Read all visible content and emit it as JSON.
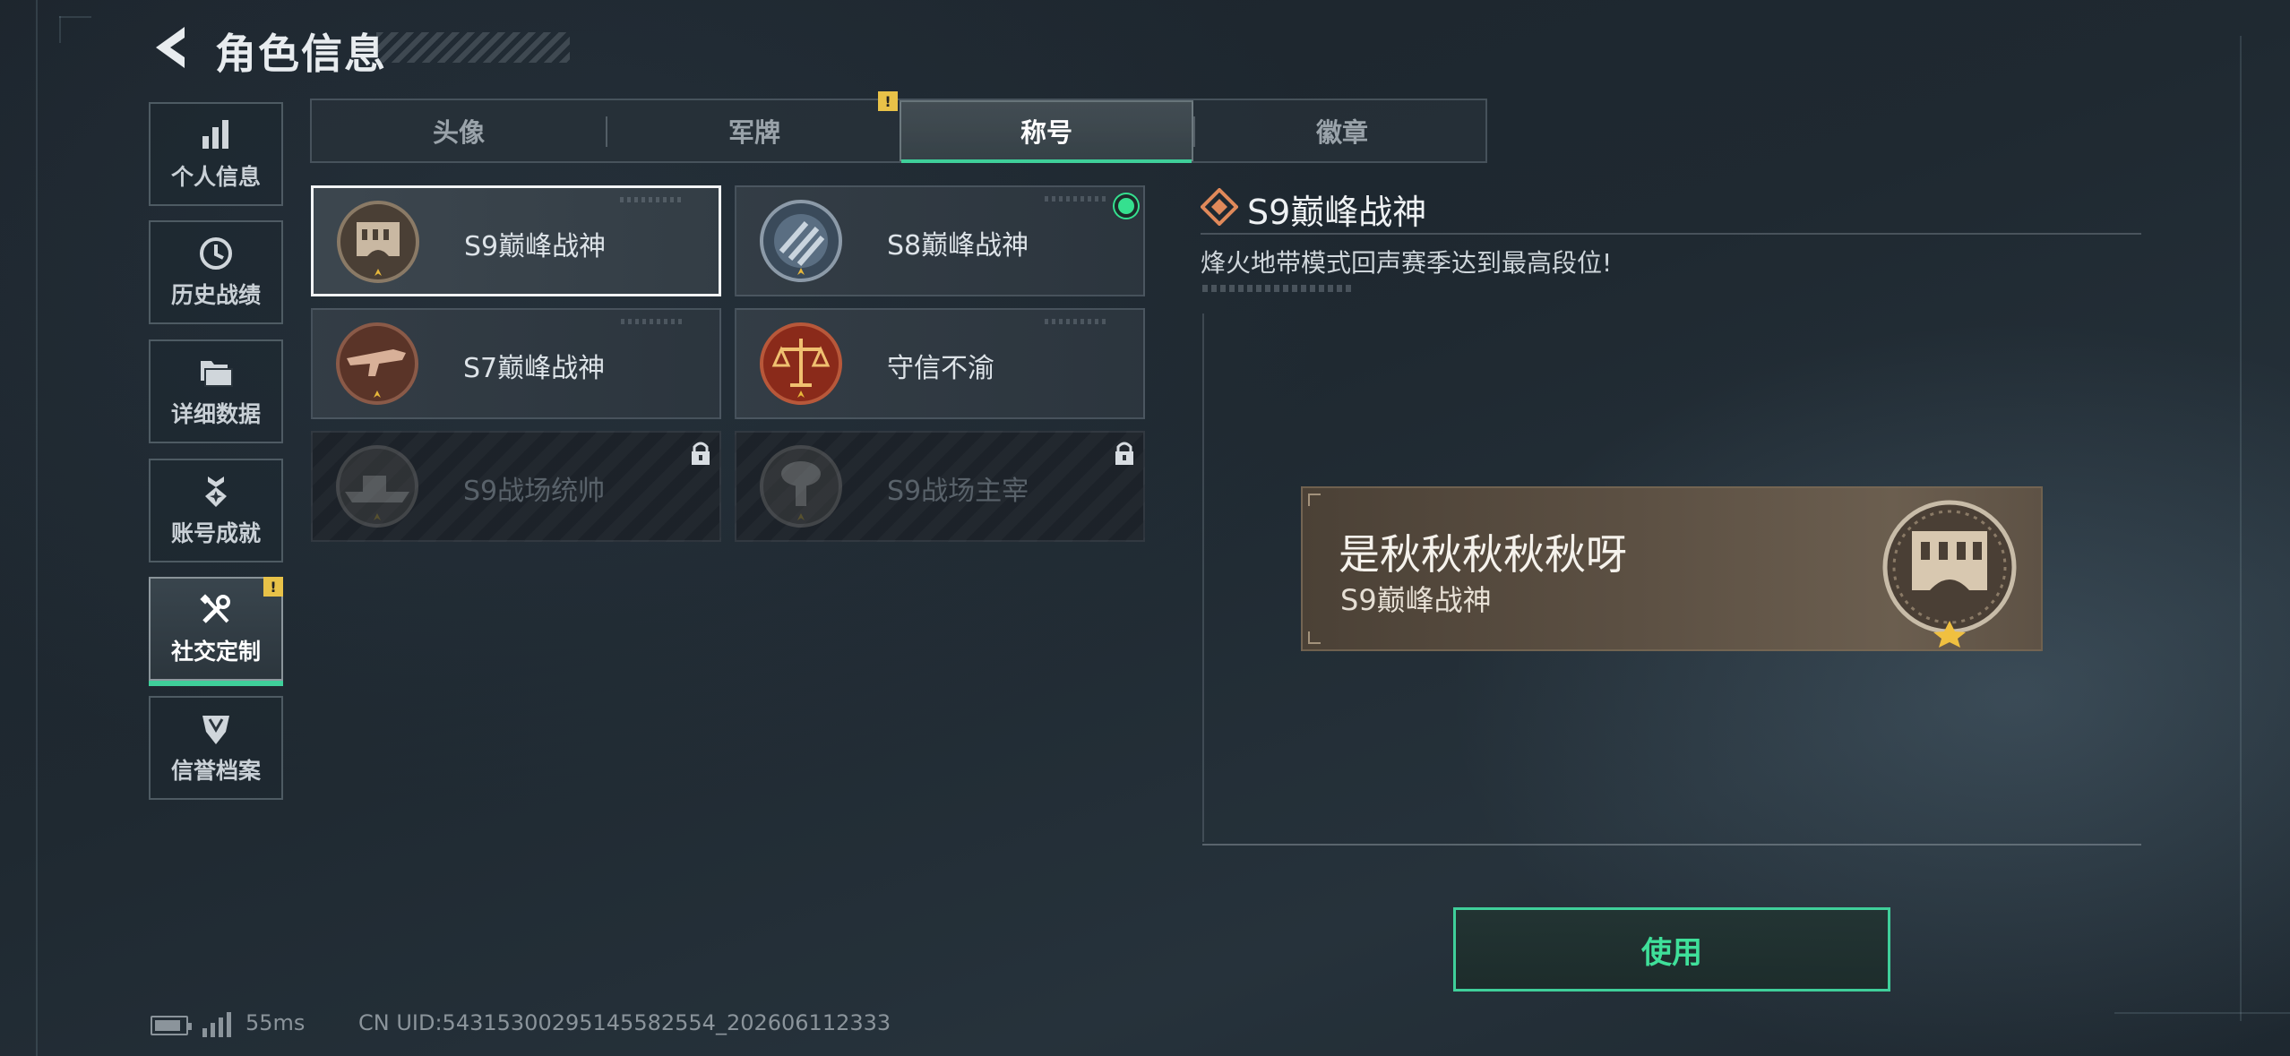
{
  "header": {
    "title": "角色信息"
  },
  "sidebar": {
    "items": [
      {
        "label": "个人信息"
      },
      {
        "label": "历史战绩"
      },
      {
        "label": "详细数据"
      },
      {
        "label": "账号成就"
      },
      {
        "label": "社交定制",
        "active": true,
        "warning": "!"
      },
      {
        "label": "信誉档案"
      }
    ]
  },
  "tabs": [
    {
      "label": "头像"
    },
    {
      "label": "军牌",
      "warning": "!"
    },
    {
      "label": "称号",
      "active": true
    },
    {
      "label": "徽章"
    }
  ],
  "titles": [
    {
      "name": "S9巅峰战神",
      "selected": true,
      "locked": false
    },
    {
      "name": "S8巅峰战神",
      "equipped": true,
      "locked": false
    },
    {
      "name": "S7巅峰战神",
      "locked": false
    },
    {
      "name": "守信不渝",
      "locked": false
    },
    {
      "name": "S9战场统帅",
      "locked": true
    },
    {
      "name": "S9战场主宰",
      "locked": true
    }
  ],
  "detail": {
    "title": "S9巅峰战神",
    "description": "烽火地带模式回声赛季达到最高段位!"
  },
  "preview": {
    "player_name": "是秋秋秋秋秋呀",
    "title": "S9巅峰战神"
  },
  "use_button": {
    "label": "使用"
  },
  "footer": {
    "ping": "55ms",
    "uid": "CN UID:5431530029514558255­4_202606112333"
  },
  "colors": {
    "accent": "#3fcf9a",
    "warning": "#e8c248",
    "equipped_dot": "#35e08f"
  }
}
